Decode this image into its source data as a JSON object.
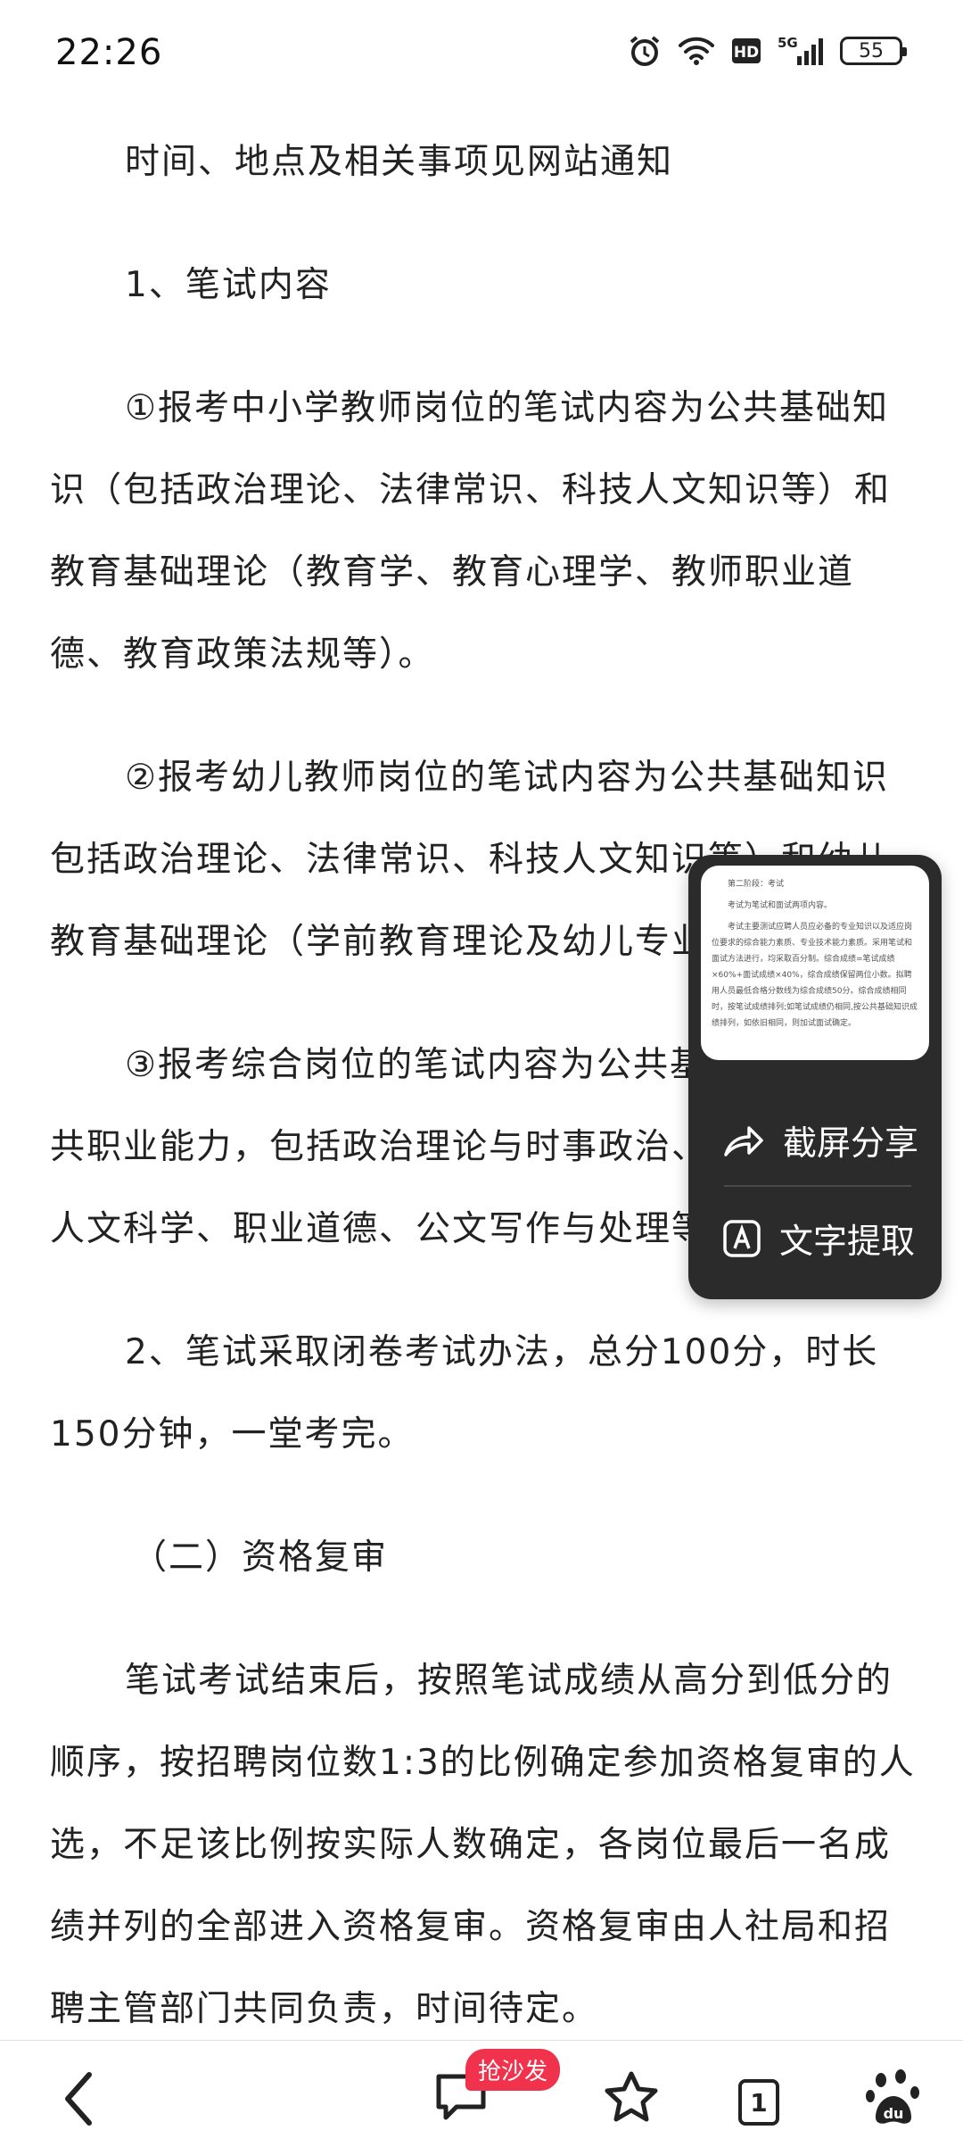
{
  "status_bar": {
    "time": "22:26",
    "network": "5G",
    "hd": "HD",
    "battery": "55",
    "icons": [
      "alarm-icon",
      "wifi-icon",
      "hd-icon",
      "signal-5g-icon",
      "battery-icon"
    ]
  },
  "article": {
    "lines": [
      "时间、地点及相关事项见网站通知",
      "1、笔试内容",
      "①报考中小学教师岗位的笔试内容为公共基础知识（包括政治理论、法律常识、科技人文知识等）和教育基础理论（教育学、教育心理学、教师职业道德、教育政策法规等）。",
      "②报考幼儿教师岗位的笔试内容为公共基础知识包括政治理论、法律常识、科技人文知识等）和幼儿教育基础理论（学前教育理论及幼儿专业知识等）。",
      "③报考综合岗位的笔试内容为公共基础知识和公共职业能力，包括政治理论与时事政治、法律常识、人文科学、职业道德、公文写作与处理等。",
      "2、笔试采取闭卷考试办法，总分100分，时长150分钟，一堂考完。",
      "（二）资格复审",
      "笔试考试结束后，按照笔试成绩从高分到低分的顺序，按招聘岗位数1:3的比例确定参加资格复审的人选，不足该比例按实际人数确定，各岗位最后一名成绩并列的全部进入资格复审。资格复审由人社局和招聘主管部门共同负责，时间待定。"
    ]
  },
  "screenshot_popup": {
    "thumbnail_lines": [
      "第二阶段：考试",
      "考试为笔试和面试两项内容。",
      "考试主要测试应聘人员应必备的专业知识以及适应岗位要求的综合能力素质、专业技术能力素质。采用笔试和面试方法进行，均采取百分制。综合成绩=笔试成绩×60%+面试成绩×40%，综合成绩保留两位小数。拟聘用人员最低合格分数线为综合成绩50分。综合成绩相同时，按笔试成绩排列;如笔试成绩仍相同,按公共基础知识成绩排列，如依旧相同，则加试面试确定。"
    ],
    "share_label": "截屏分享",
    "extract_label": "文字提取"
  },
  "bottom_bar": {
    "comment_badge": "抢沙发",
    "tab_count": "1",
    "icons": [
      "back-icon",
      "comment-icon",
      "star-icon",
      "tabs-icon",
      "paw-icon"
    ]
  }
}
